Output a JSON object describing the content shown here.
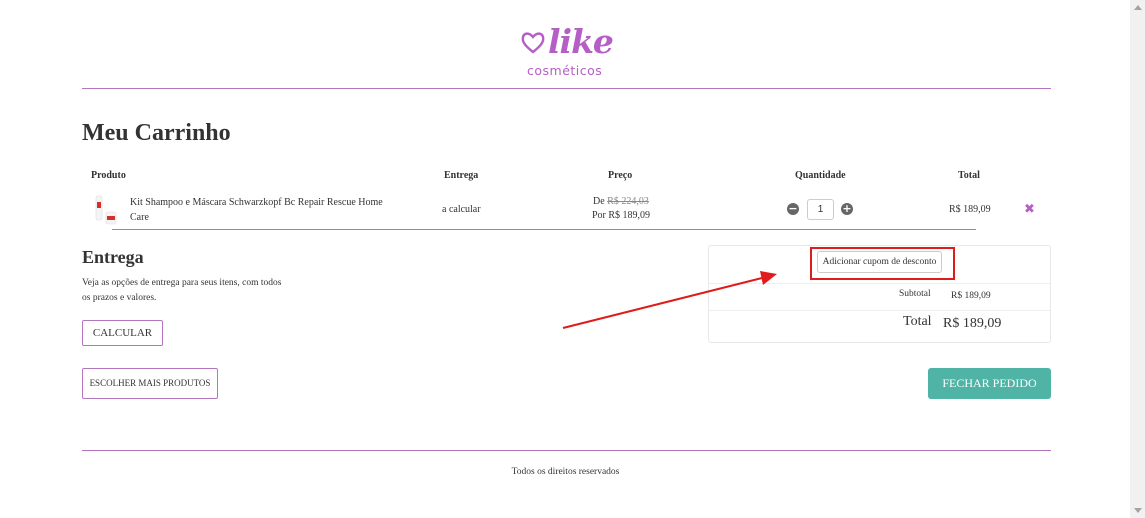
{
  "brand": {
    "logo_word": "like",
    "logo_sub": "cosméticos",
    "accent_color": "#b55ec5",
    "checkout_color": "#4fb3a5"
  },
  "page_title": "Meu Carrinho",
  "table": {
    "headers": [
      "Produto",
      "Entrega",
      "Preço",
      "Quantidade",
      "Total"
    ],
    "rows": [
      {
        "product": "Kit Shampoo e Máscara Schwarzkopf Bc Repair Rescue Home Care",
        "delivery": "a calcular",
        "price_from_label": "De",
        "price_from": "R$ 224,03",
        "price_by": "Por R$ 189,09",
        "quantity": "1",
        "total": "R$ 189,09"
      }
    ]
  },
  "shipping": {
    "title": "Entrega",
    "description": "Veja as opções de entrega para seus itens, com todos os prazos e valores.",
    "calculate_label": "CALCULAR"
  },
  "summary": {
    "coupon_label": "Adicionar cupom de desconto",
    "subtotal_label": "Subtotal",
    "subtotal_value": "R$ 189,09",
    "total_label": "Total",
    "total_value": "R$ 189,09"
  },
  "actions": {
    "more_products_label": "ESCOLHER MAIS PRODUTOS",
    "checkout_label": "FECHAR PEDIDO"
  },
  "footer": {
    "text": "Todos os direitos reservados"
  },
  "annotation_color": "#e01b1b"
}
